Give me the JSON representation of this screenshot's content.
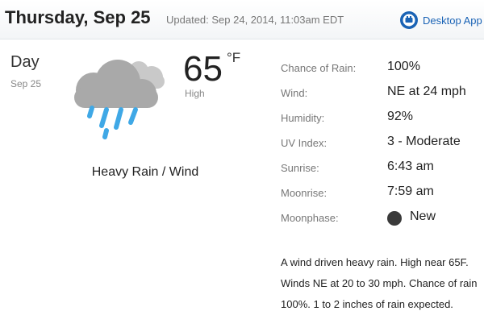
{
  "header": {
    "title": "Thursday, Sep 25",
    "updated": "Updated: Sep 24, 2014, 11:03am EDT",
    "desktop_app": {
      "label": "Desktop App",
      "icon": "desktop-app-logo-icon",
      "color": "#1a63b5"
    }
  },
  "forecast": {
    "period": "Day",
    "date": "Sep 25",
    "icon": "heavy-rain-cloud-icon",
    "temperature": "65",
    "unit": "°F",
    "temp_label": "High",
    "condition": "Heavy Rain / Wind"
  },
  "details": [
    {
      "label": "Chance of Rain:",
      "value": "100%"
    },
    {
      "label": "Wind:",
      "value": "NE at 24 mph"
    },
    {
      "label": "Humidity:",
      "value": "92%"
    },
    {
      "label": "UV Index:",
      "value": "3 - Moderate"
    },
    {
      "label": "Sunrise:",
      "value": "6:43 am"
    },
    {
      "label": "Moonrise:",
      "value": "7:59 am"
    },
    {
      "label": "Moonphase:",
      "value": "New",
      "icon": "new-moon-icon"
    }
  ],
  "summary": "A wind driven heavy rain. High near 65F. Winds NE at 20 to 30 mph. Chance of rain 100%. 1 to 2 inches of rain expected."
}
